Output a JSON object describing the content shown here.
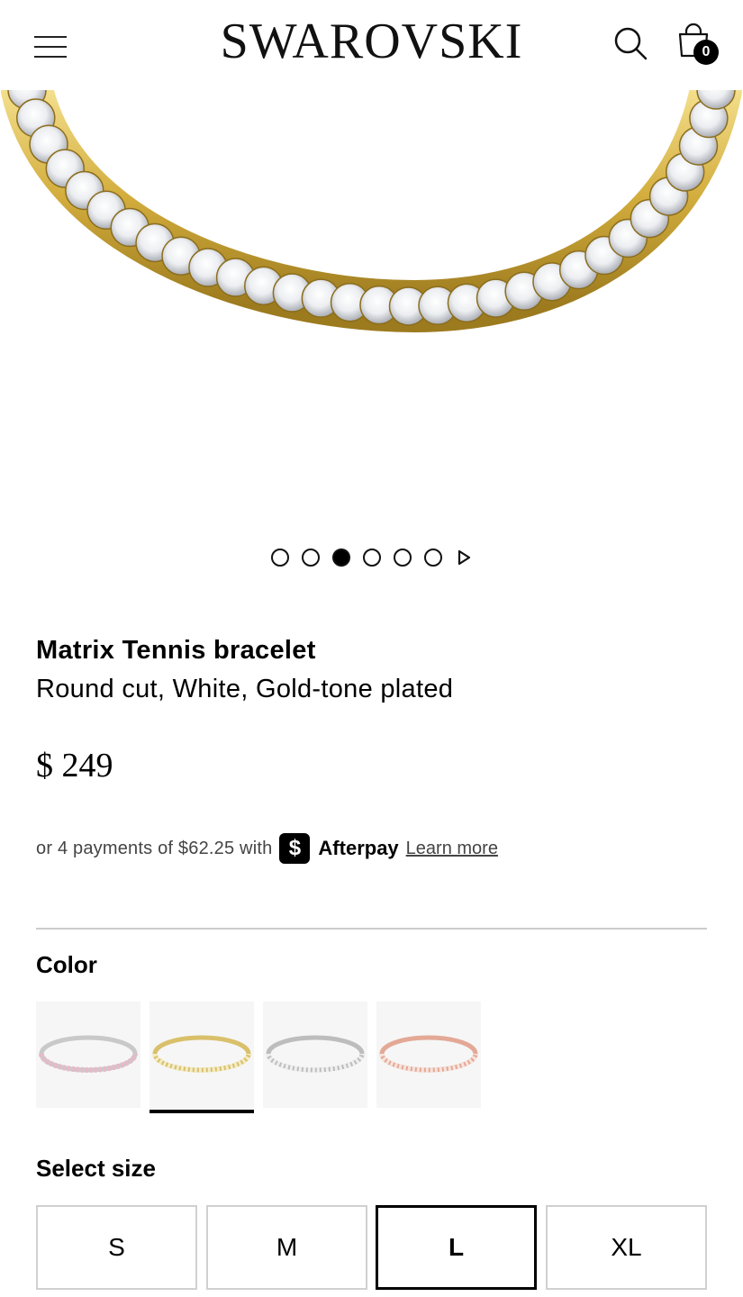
{
  "header": {
    "logo": "SWAROVSKI",
    "bag_count": "0",
    "icons": {
      "menu": "hamburger-menu-icon",
      "search": "search-icon",
      "bag": "shopping-bag-icon"
    }
  },
  "gallery": {
    "slide_count": 6,
    "active_slide": 3,
    "play_icon": "play-icon"
  },
  "product": {
    "name": "Matrix Tennis bracelet",
    "description": "Round cut, White, Gold-tone plated",
    "price": "$ 249"
  },
  "afterpay": {
    "text": "or 4 payments of $62.25 with",
    "badge_symbol": "$",
    "brand": "Afterpay",
    "learn_more": "Learn more"
  },
  "color": {
    "title": "Color",
    "selected_index": 1,
    "swatch_colors": [
      "#e8b9c9",
      "#e6d38c",
      "#d8d8d8",
      "#e9b6a8"
    ]
  },
  "size": {
    "title": "Select size",
    "options": [
      "S",
      "M",
      "L",
      "XL"
    ],
    "selected": "L"
  },
  "colors": {
    "accent": "#000000",
    "divider": "#cccccc",
    "gold": "#d7b441"
  }
}
